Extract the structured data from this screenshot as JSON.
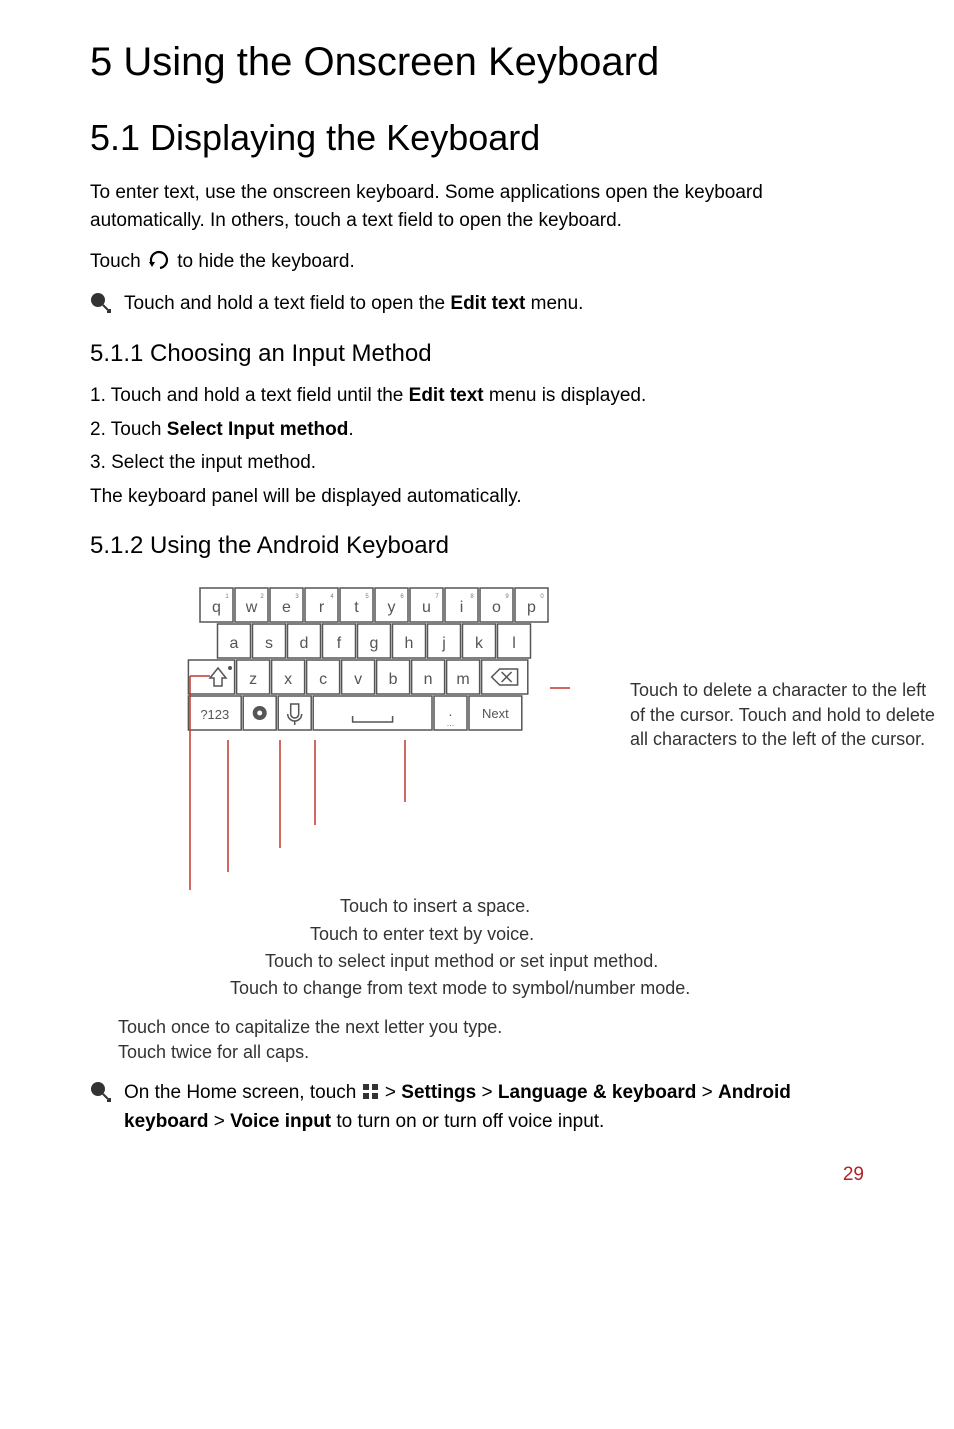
{
  "chapter_title": "5  Using the Onscreen Keyboard",
  "section_title": "5.1  Displaying the Keyboard",
  "intro_p1": "To enter text, use the onscreen keyboard. Some applications open the keyboard automatically. In others, touch a text field to open the keyboard.",
  "intro_p2_pre": "Touch ",
  "intro_p2_post": " to hide the keyboard.",
  "note1_pre": "Touch and hold a text field to open the ",
  "note1_bold": "Edit text",
  "note1_post": " menu.",
  "subsec1_title": "5.1.1  Choosing an Input Method",
  "steps": {
    "s1_pre": "1. Touch and hold a text field until the ",
    "s1_bold": "Edit text",
    "s1_post": " menu is displayed.",
    "s2_pre": "2. Touch ",
    "s2_bold": "Select Input method",
    "s2_post": ".",
    "s3": "3. Select the input method."
  },
  "after_steps": "The keyboard panel will be displayed automatically.",
  "subsec2_title": "5.1.2  Using the Android Keyboard",
  "keyboard": {
    "row1": [
      {
        "k": "q",
        "n": "1"
      },
      {
        "k": "w",
        "n": "2"
      },
      {
        "k": "e",
        "n": "3"
      },
      {
        "k": "r",
        "n": "4"
      },
      {
        "k": "t",
        "n": "5"
      },
      {
        "k": "y",
        "n": "6"
      },
      {
        "k": "u",
        "n": "7"
      },
      {
        "k": "i",
        "n": "8"
      },
      {
        "k": "o",
        "n": "9"
      },
      {
        "k": "p",
        "n": "0"
      }
    ],
    "row2": [
      "a",
      "s",
      "d",
      "f",
      "g",
      "h",
      "j",
      "k",
      "l"
    ],
    "row3": [
      "z",
      "x",
      "c",
      "v",
      "b",
      "n",
      "m"
    ],
    "sym_key": "?123",
    "next_key": "Next",
    "period_key": "."
  },
  "callout_right": "Touch to delete a character to the left of the cursor. Touch and hold to delete all characters to the left of the cursor.",
  "callouts": {
    "space": "Touch to insert a space.",
    "voice": "Touch to enter text by voice.",
    "method": "Touch to select input method or set input method.",
    "mode": "Touch to change from text mode to symbol/number mode."
  },
  "caps_l1": "Touch once to capitalize the next letter you type.",
  "caps_l2": "Touch twice for all caps.",
  "note2_pre": "On the Home screen, touch ",
  "note2_mid1": "  > ",
  "note2_b1": "Settings",
  "note2_gt1": " > ",
  "note2_b2": "Language & keyboard",
  "note2_gt2": " > ",
  "note2_b3": "Android keyboard",
  "note2_gt3": " > ",
  "note2_b4": "Voice input",
  "note2_post": " to turn on or turn off voice input.",
  "page_number": "29"
}
